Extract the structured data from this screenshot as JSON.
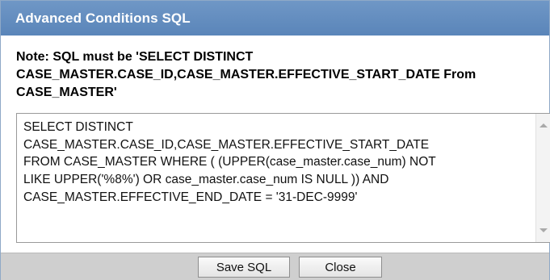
{
  "dialog": {
    "title": "Advanced Conditions SQL",
    "note": "Note: SQL must be 'SELECT DISTINCT\nCASE_MASTER.CASE_ID,CASE_MASTER.EFFECTIVE_START_DATE From\nCASE_MASTER'",
    "sql_value": "SELECT DISTINCT\nCASE_MASTER.CASE_ID,CASE_MASTER.EFFECTIVE_START_DATE\nFROM CASE_MASTER WHERE  ( (UPPER(case_master.case_num) NOT\nLIKE UPPER('%8%') OR case_master.case_num IS NULL )) AND\nCASE_MASTER.EFFECTIVE_END_DATE = '31-DEC-9999'",
    "buttons": {
      "save_label": "Save SQL",
      "close_label": "Close"
    }
  },
  "colors": {
    "titlebar": "#5f8bbf",
    "title_text": "#ffffff",
    "footer": "#cfcfcf"
  },
  "icons": {
    "scroll_up": "scroll-up-arrow-icon",
    "scroll_down": "scroll-down-arrow-icon"
  }
}
